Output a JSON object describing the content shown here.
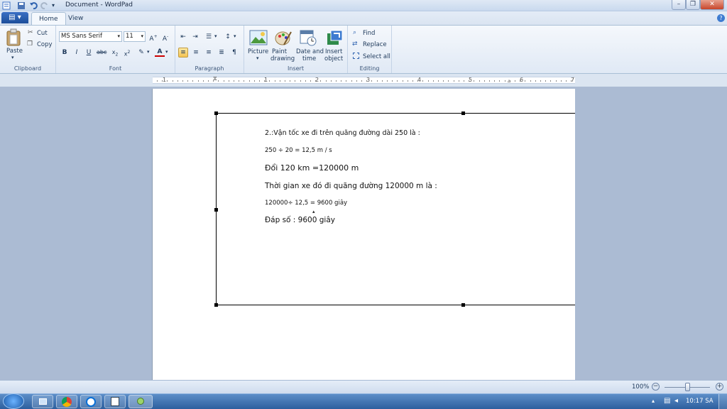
{
  "window": {
    "title": "Document - WordPad"
  },
  "tabs": [
    {
      "label": "Home"
    },
    {
      "label": "View"
    }
  ],
  "ribbon": {
    "clipboard": {
      "label": "Clipboard",
      "paste": "Paste",
      "cut": "Cut",
      "copy": "Copy"
    },
    "font": {
      "label": "Font",
      "family": "MS Sans Serif",
      "size": "11"
    },
    "paragraph": {
      "label": "Paragraph"
    },
    "insert": {
      "label": "Insert",
      "picture": "Picture",
      "paint1": "Paint",
      "paint2": "drawing",
      "date1": "Date and",
      "date2": "time",
      "obj1": "Insert",
      "obj2": "object"
    },
    "editing": {
      "label": "Editing",
      "find": "Find",
      "replace": "Replace",
      "select_all": "Select all"
    }
  },
  "ruler": {
    "numbers": [
      "1",
      "1",
      "2",
      "3",
      "4",
      "5",
      "6",
      "7"
    ]
  },
  "document": {
    "lines": [
      "2.:Vận tốc xe đi trên quãng đường dài 250  là :",
      "250 ÷ 20 = 12,5 m / s",
      "Đổi 120 km =120000 m",
      "Thời gian xe đó đi quãng đường 120000 m là :",
      "120000÷ 12,5 = 9600 giây",
      "Đáp số : 9600 giây"
    ]
  },
  "status": {
    "zoom": "100%"
  },
  "taskbar": {
    "clock": "10:17 SA"
  },
  "colors": {
    "ribbon_bg": "#e0e9f5",
    "workspace": "#abbbd3",
    "taskbar": "#2d5f9e",
    "file_button": "#1c4e9a"
  }
}
